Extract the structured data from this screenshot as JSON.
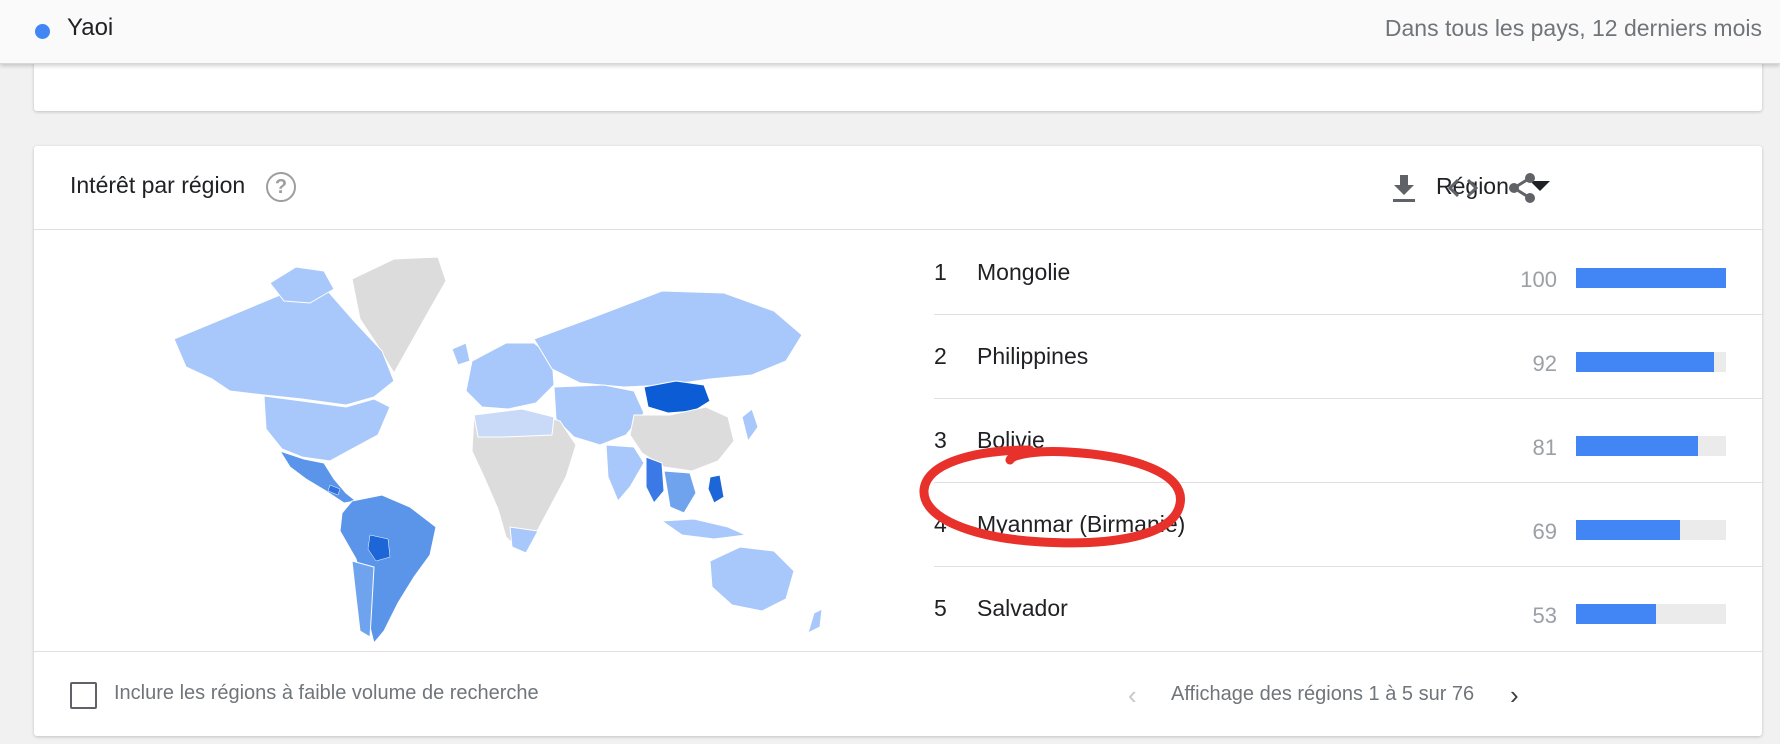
{
  "topbar": {
    "term": "Yaoi",
    "term_color": "#4285f4",
    "scope": "Dans tous les pays, 12 derniers mois"
  },
  "card": {
    "title": "Intérêt par région",
    "help_icon": "question-circle-icon",
    "select_label": "Région",
    "tools": [
      "download-icon",
      "embed-code-icon",
      "share-icon"
    ]
  },
  "regions": [
    {
      "rank": "1",
      "name": "Mongolie",
      "value": 100
    },
    {
      "rank": "2",
      "name": "Philippines",
      "value": 92
    },
    {
      "rank": "3",
      "name": "Bolivie",
      "value": 81
    },
    {
      "rank": "4",
      "name": "Myanmar (Birmanie)",
      "value": 69
    },
    {
      "rank": "5",
      "name": "Salvador",
      "value": 53
    }
  ],
  "footer": {
    "checkbox_label": "Inclure les régions à faible volume de recherche",
    "pager_text": "Affichage des régions 1 à 5 sur 76"
  },
  "colors": {
    "bar": "#4285f4",
    "map_high": "#0b5cd5",
    "map_mid": "#5a95ea",
    "map_low": "#a8c7fa",
    "map_none": "#dcdcdc",
    "annotation": "#e8312a"
  }
}
